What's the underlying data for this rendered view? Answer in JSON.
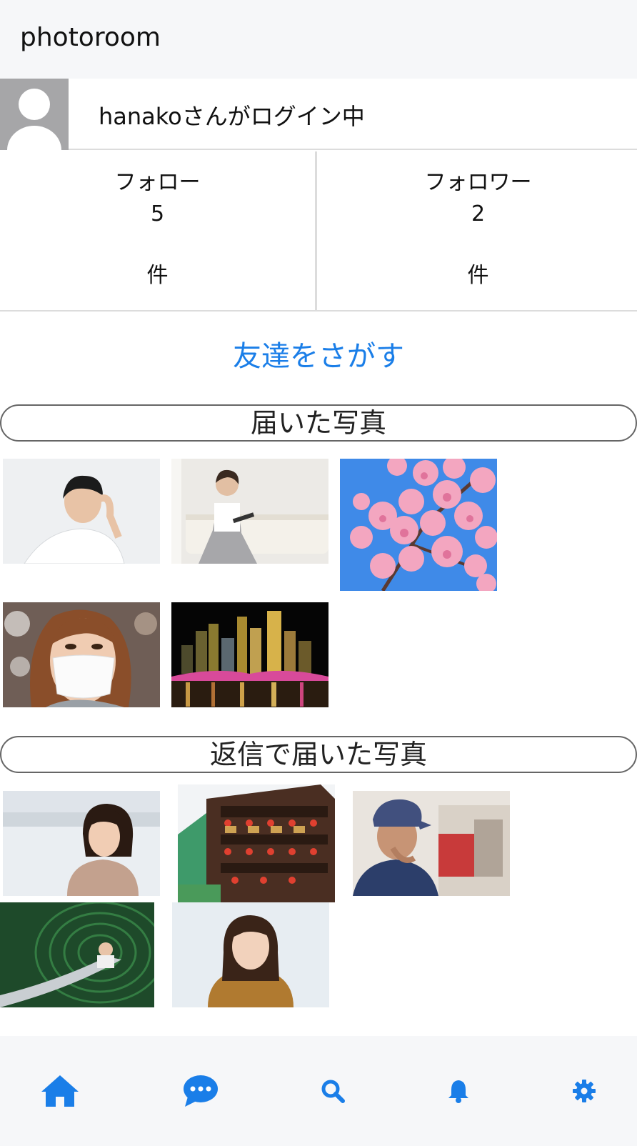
{
  "app": {
    "title": "photoroom"
  },
  "profile": {
    "login_text": "hanakoさんがログイン中"
  },
  "stats": {
    "follow": {
      "label": "フォロー",
      "count": "5",
      "unit": "件"
    },
    "follower": {
      "label": "フォロワー",
      "count": "2",
      "unit": "件"
    }
  },
  "actions": {
    "find_friends": "友達をさがす"
  },
  "sections": {
    "received": {
      "title": "届いた写真"
    },
    "replied": {
      "title": "返信で届いた写真"
    }
  },
  "colors": {
    "accent": "#1a7ee8",
    "header_bg": "#f6f7f9",
    "avatar_bg": "#a6a6a8"
  },
  "tabbar": {
    "items": [
      {
        "icon": "home-icon"
      },
      {
        "icon": "chat-bubble-icon"
      },
      {
        "icon": "search-icon"
      },
      {
        "icon": "bell-icon"
      },
      {
        "icon": "gear-icon"
      }
    ]
  }
}
